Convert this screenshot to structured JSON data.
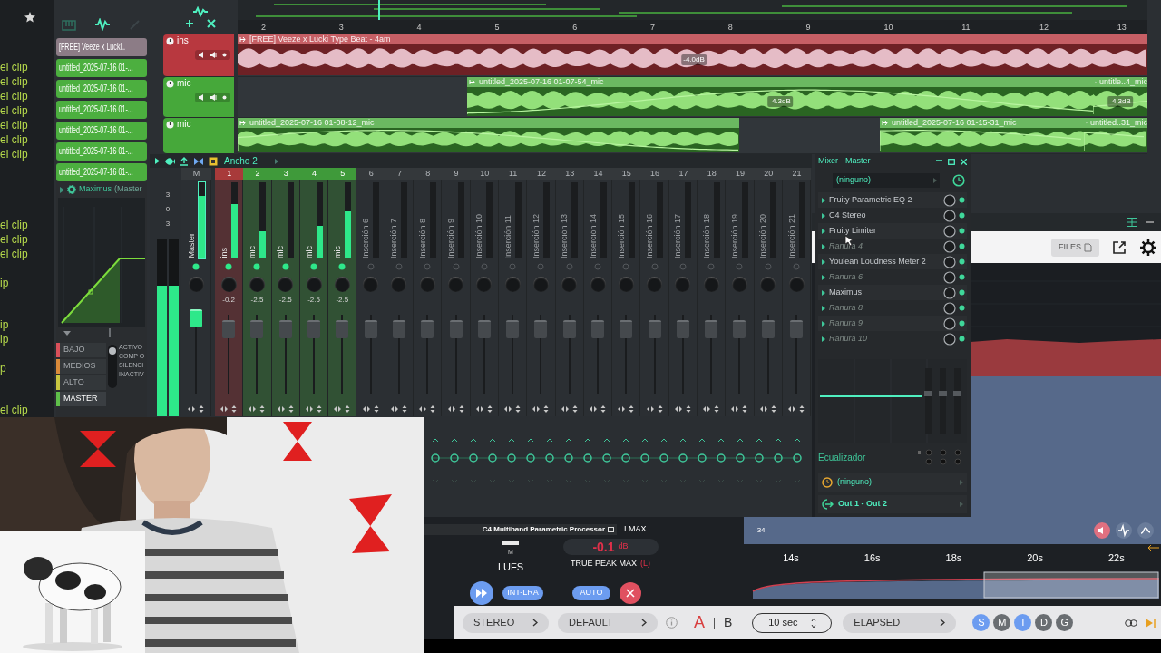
{
  "browser": {
    "clip_groups": [
      [
        "el clip",
        "el clip",
        "el clip",
        "el clip",
        "el clip",
        "el clip",
        "el clip"
      ],
      [
        "el clip",
        "el clip",
        "el clip"
      ],
      [
        "ip"
      ],
      [
        "ip",
        "ip"
      ],
      [
        "p"
      ],
      [
        "el clip"
      ]
    ]
  },
  "playlist": {
    "ruler": [
      "2",
      "3",
      "4",
      "5",
      "6",
      "7",
      "8",
      "9",
      "10",
      "11",
      "12",
      "13"
    ],
    "picker": [
      {
        "label": "[FREE] Veeze x Lucki..",
        "color": "#8c7c86"
      },
      {
        "label": "untitled_2025-07-16 01-...",
        "color": "#4caf3f"
      },
      {
        "label": "untitled_2025-07-16 01-...",
        "color": "#4caf3f"
      },
      {
        "label": "untitled_2025-07-16 01-...",
        "color": "#4caf3f"
      },
      {
        "label": "untitled_2025-07-16 01-...",
        "color": "#4caf3f"
      },
      {
        "label": "untitled_2025-07-16 01-...",
        "color": "#4caf3f"
      },
      {
        "label": "untitled_2025-07-16 01-...",
        "color": "#4caf3f"
      }
    ],
    "tracks": [
      {
        "name": "ins",
        "kind": "full",
        "color": "#b8383f",
        "clips": [
          {
            "title": "[FREE] Veeze x Lucki Type Beat - 4am",
            "gain": "-4.0dB"
          }
        ]
      },
      {
        "name": "mic",
        "kind": "full",
        "color": "#46a83a",
        "clips": [
          {
            "title": "untitled_2025-07-16 01-07-54_mic",
            "gain": "-4.3dB"
          },
          {
            "title": "untitle..4_mic",
            "gain": "-4.3dB"
          }
        ]
      },
      {
        "name": "mic",
        "kind": "compact",
        "color": "#46a83a",
        "clips": [
          {
            "title": "untitled_2025-07-16 01-08-12_mic"
          },
          {
            "title": "untitled_2025-07-16 01-15-31_mic"
          },
          {
            "title": "untitled..31_mic"
          }
        ]
      }
    ]
  },
  "maximus": {
    "title": "Maximus",
    "subtitle": "(Master",
    "bands": [
      {
        "label": "BAJO",
        "color": "#d9505a",
        "selected": false
      },
      {
        "label": "MEDIOS",
        "color": "#d98a3a",
        "selected": false
      },
      {
        "label": "ALTO",
        "color": "#c9c640",
        "selected": false
      },
      {
        "label": "MASTER",
        "color": "#5fbf4a",
        "selected": true
      }
    ],
    "modes": [
      "ACTIVO",
      "COMP O",
      "SILENCI",
      "INACTIV"
    ]
  },
  "mixer": {
    "preset": "Ancho 2",
    "meter_scale": [
      "3",
      "0",
      "3"
    ],
    "main_meter": {
      "level": 0.74
    },
    "master": {
      "number": "M",
      "name": "Master",
      "level": 0.82
    },
    "strips": [
      {
        "number": "1",
        "name": "ins",
        "color": "#a83a3a",
        "value": "-0.2",
        "level": 0.72
      },
      {
        "number": "2",
        "name": "mic",
        "color": "#3f9a3a",
        "value": "-2.5",
        "level": 0.36
      },
      {
        "number": "3",
        "name": "mic",
        "color": "#3f9a3a",
        "value": "-2.5",
        "level": 0
      },
      {
        "number": "4",
        "name": "mic",
        "color": "#3f9a3a",
        "value": "-2.5",
        "level": 0.43
      },
      {
        "number": "5",
        "name": "mic",
        "color": "#3f9a3a",
        "value": "-2.5",
        "level": 0.62
      },
      {
        "number": "6",
        "name": "Inserción 6"
      },
      {
        "number": "7",
        "name": "Inserción 7"
      },
      {
        "number": "8",
        "name": "Inserción 8"
      },
      {
        "number": "9",
        "name": "Inserción 9"
      },
      {
        "number": "10",
        "name": "Inserción 10"
      },
      {
        "number": "11",
        "name": "Inserción 11"
      },
      {
        "number": "12",
        "name": "Inserción 12"
      },
      {
        "number": "13",
        "name": "Inserción 13"
      },
      {
        "number": "14",
        "name": "Inserción 14"
      },
      {
        "number": "15",
        "name": "Inserción 15"
      },
      {
        "number": "16",
        "name": "Inserción 16"
      },
      {
        "number": "17",
        "name": "Inserción 17"
      },
      {
        "number": "18",
        "name": "Inserción 18"
      },
      {
        "number": "19",
        "name": "Inserción 19"
      },
      {
        "number": "20",
        "name": "Inserción 20"
      },
      {
        "number": "21",
        "name": "Inserción 21"
      }
    ]
  },
  "master_panel": {
    "title": "Mixer - Master",
    "input": "(ninguno)",
    "slots": [
      {
        "name": "Fruity Parametric EQ 2",
        "empty": false
      },
      {
        "name": "C4 Stereo",
        "empty": false
      },
      {
        "name": "Fruity Limiter",
        "empty": false
      },
      {
        "name": "Ranura 4",
        "empty": true
      },
      {
        "name": "Youlean Loudness Meter 2",
        "empty": false
      },
      {
        "name": "Ranura 6",
        "empty": true
      },
      {
        "name": "Maximus",
        "empty": false
      },
      {
        "name": "Ranura 8",
        "empty": true
      },
      {
        "name": "Ranura 9",
        "empty": true
      },
      {
        "name": "Ranura 10",
        "empty": true
      }
    ],
    "eq_label": "Ecualizador",
    "sidechain": "(ninguno)",
    "output": "Out 1 - Out 2"
  },
  "loudness": {
    "files": "FILES",
    "scale_label": "-34",
    "time_labels": [
      "14s",
      "16s",
      "18s",
      "20s",
      "22s"
    ],
    "plugin_footer": "C4 Multiband Parametric Processor",
    "max_label": "I MAX",
    "meter_mode": "M",
    "lufs": "LUFS",
    "peak_value": "-0.1",
    "peak_unit": "dB",
    "peak_label": "TRUE PEAK MAX",
    "peak_channel": "(L)",
    "int_lra": "INT-LRA",
    "auto": "AUTO",
    "bar": {
      "channel": "STEREO",
      "preset": "DEFAULT",
      "window": "10 sec",
      "time_mode": "ELAPSED",
      "ab": [
        {
          "label": "A",
          "selected": true
        },
        {
          "label": "B",
          "selected": false
        }
      ],
      "views": [
        {
          "label": "S",
          "selected": true
        },
        {
          "label": "M",
          "selected": false
        },
        {
          "label": "T",
          "selected": true
        },
        {
          "label": "D",
          "selected": false
        },
        {
          "label": "G",
          "selected": false
        }
      ]
    }
  }
}
